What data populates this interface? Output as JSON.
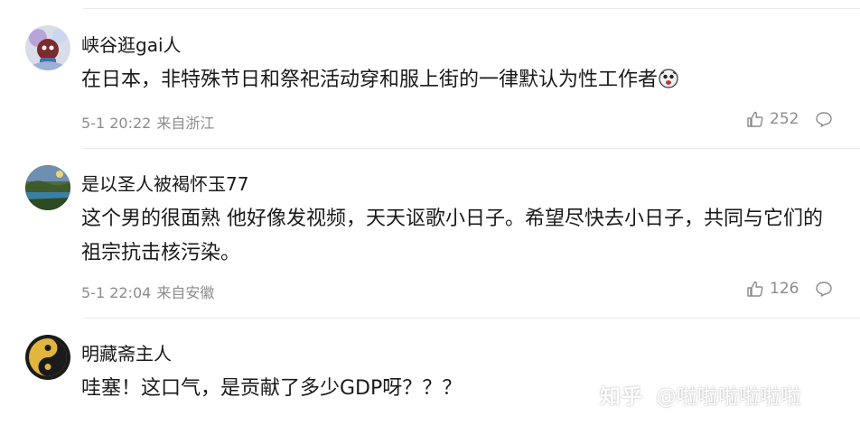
{
  "comments": [
    {
      "username": "峡谷逛gai人",
      "content": "在日本，非特殊节日和祭祀活动穿和服上街的一律默认为性工作者",
      "date": "5-1 20:22",
      "location": "来自浙江",
      "likes": "252",
      "avatar_icon": "cartoon-avatar-icon",
      "emoji_icon": "emoji-icon"
    },
    {
      "username": "是以圣人被褐怀玉77",
      "content": "这个男的很面熟 他好像发视频，天天讴歌小日子。希望尽快去小日子，共同与它们的祖宗抗击核污染。",
      "date": "5-1 22:04",
      "location": "来自安徽",
      "likes": "126",
      "avatar_icon": "landscape-avatar-icon"
    },
    {
      "username": "明藏斋主人",
      "content": "哇塞！这口气，是贡献了多少GDP呀？？？",
      "avatar_icon": "yin-yang-avatar-icon"
    }
  ],
  "watermark": {
    "brand": "知乎",
    "handle": "@啦啦啦啦啦啦"
  },
  "colors": {
    "text": "#1a1a1a",
    "meta": "#8c8c8c",
    "divider": "#e8e8e8"
  }
}
